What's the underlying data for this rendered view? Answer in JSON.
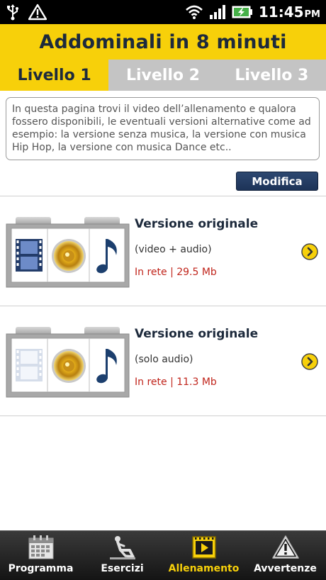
{
  "status_bar": {
    "time": "11:45",
    "time_suffix": "PM",
    "icons": [
      "usb-icon",
      "warning-icon",
      "wifi-icon",
      "signal-icon",
      "battery-charging-icon"
    ]
  },
  "header": {
    "title": "Addominali in 8 minuti"
  },
  "tabs": [
    {
      "label": "Livello 1",
      "active": true
    },
    {
      "label": "Livello 2",
      "active": false
    },
    {
      "label": "Livello 3",
      "active": false
    }
  ],
  "description": "In questa pagina trovi il video dell’allenamento e qualora fossero disponibili, le eventuali versioni alternative come ad esempio: la versione senza musica, la versione con musica Hip Hop, la versione con musica Dance etc..",
  "edit_button": "Modifica",
  "versions": [
    {
      "title": "Versione originale",
      "subtitle": "(video + audio)",
      "meta": "In rete | 29.5 Mb",
      "icons": [
        "film-icon",
        "speaker-icon",
        "music-note-icon"
      ]
    },
    {
      "title": "Versione originale",
      "subtitle": "(solo audio)",
      "meta": "In rete | 11.3 Mb",
      "icons": [
        "film-disabled-icon",
        "speaker-icon",
        "music-note-icon"
      ]
    }
  ],
  "bottom_nav": [
    {
      "label": "Programma",
      "icon": "calendar-icon",
      "active": false
    },
    {
      "label": "Esercizi",
      "icon": "situp-figure-icon",
      "active": false
    },
    {
      "label": "Allenamento",
      "icon": "play-video-icon",
      "active": true
    },
    {
      "label": "Avvertenze",
      "icon": "warning-triangle-icon",
      "active": false
    }
  ],
  "colors": {
    "accent_yellow": "#f7d00a",
    "title_navy": "#1d2a3c",
    "meta_red": "#c0241b",
    "button_navy": "#1d3358"
  }
}
